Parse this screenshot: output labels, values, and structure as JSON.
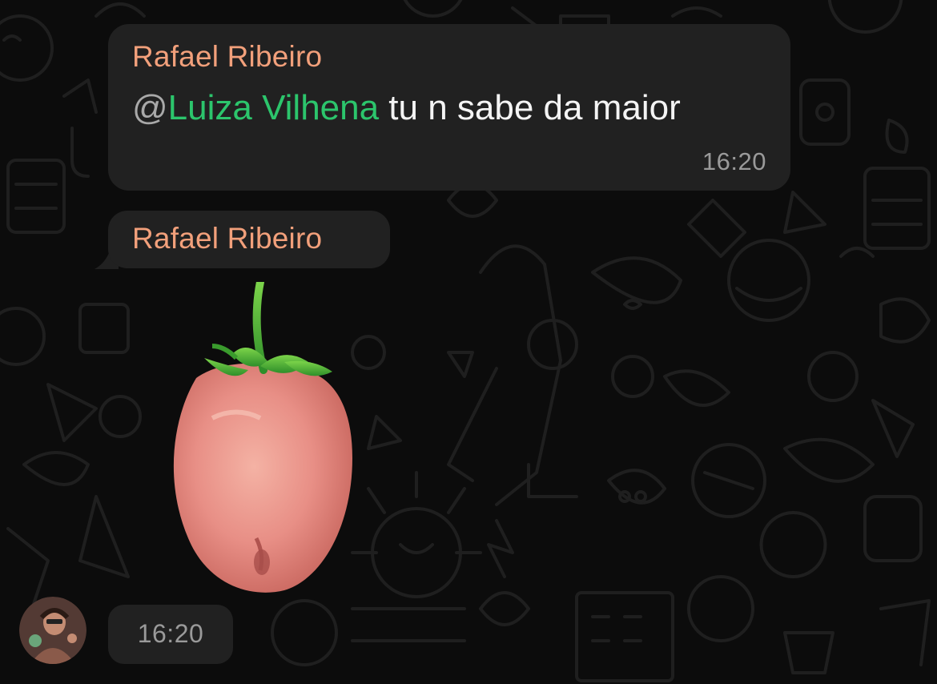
{
  "messages": [
    {
      "sender": "Rafael Ribeiro",
      "mention_prefix": "@",
      "mention_name": "Luiza Vilhena",
      "text": " tu n sabe da maior",
      "time": "16:20"
    },
    {
      "sender": "Rafael Ribeiro",
      "sticker_icon": "strawberry-tongue-sticker",
      "time": "16:20"
    }
  ],
  "colors": {
    "background": "#0c0c0c",
    "bubble": "#212121",
    "sender_name": "#f2a07b",
    "mention": "#2cc56c",
    "timestamp": "#9a9a9a",
    "pattern": "#1f1f1f"
  },
  "icons": {
    "avatar": "user-avatar-photo"
  }
}
